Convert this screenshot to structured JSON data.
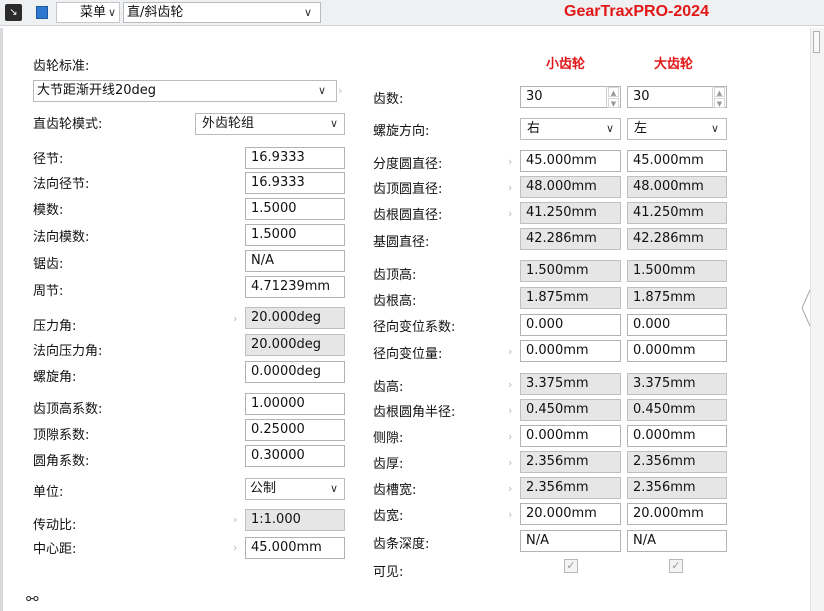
{
  "toolbar": {
    "menu_label": "菜单",
    "gear_type": "直/斜齿轮",
    "app_title": "GearTraxPRO-2024"
  },
  "left": {
    "standard_label": "齿轮标准:",
    "standard_value": "大节距渐开线20deg",
    "mode_label": "直齿轮模式:",
    "mode_value": "外齿轮组",
    "rows": [
      {
        "label": "径节:",
        "value": "16.9333"
      },
      {
        "label": "法向径节:",
        "value": "16.9333"
      },
      {
        "label": "模数:",
        "value": "1.5000"
      },
      {
        "label": "法向模数:",
        "value": "1.5000"
      },
      {
        "label": "锯齿:",
        "value": "N/A"
      },
      {
        "label": "周节:",
        "value": "4.71239mm"
      },
      {
        "label": "压力角:",
        "value": "20.000deg"
      },
      {
        "label": "法向压力角:",
        "value": "20.000deg"
      },
      {
        "label": "螺旋角:",
        "value": "0.0000deg"
      },
      {
        "label": "齿顶高系数:",
        "value": "1.00000"
      },
      {
        "label": "顶隙系数:",
        "value": "0.25000"
      },
      {
        "label": "圆角系数:",
        "value": "0.30000"
      }
    ],
    "unit_label": "单位:",
    "unit_value": "公制",
    "ratio_label": "传动比:",
    "ratio_value": "1:1.000",
    "center_label": "中心距:",
    "center_value": "45.000mm"
  },
  "right": {
    "pinion_header": "小齿轮",
    "gear_header": "大齿轮",
    "teeth_label": "齿数:",
    "pinion_teeth": "30",
    "gear_teeth": "30",
    "helix_label": "螺旋方向:",
    "pinion_helix": "右",
    "gear_helix": "左",
    "rows": [
      {
        "label": "分度圆直径:",
        "pinion": "45.000mm",
        "gear": "45.000mm"
      },
      {
        "label": "齿顶圆直径:",
        "pinion": "48.000mm",
        "gear": "48.000mm"
      },
      {
        "label": "齿根圆直径:",
        "pinion": "41.250mm",
        "gear": "41.250mm"
      },
      {
        "label": "基圆直径:",
        "pinion": "42.286mm",
        "gear": "42.286mm"
      },
      {
        "label": "齿顶高:",
        "pinion": "1.500mm",
        "gear": "1.500mm"
      },
      {
        "label": "齿根高:",
        "pinion": "1.875mm",
        "gear": "1.875mm"
      },
      {
        "label": "径向变位系数:",
        "pinion": "0.000",
        "gear": "0.000"
      },
      {
        "label": "径向变位量:",
        "pinion": "0.000mm",
        "gear": "0.000mm"
      },
      {
        "label": "齿高:",
        "pinion": "3.375mm",
        "gear": "3.375mm"
      },
      {
        "label": "齿根圆角半径:",
        "pinion": "0.450mm",
        "gear": "0.450mm"
      },
      {
        "label": "侧隙:",
        "pinion": "0.000mm",
        "gear": "0.000mm"
      },
      {
        "label": "齿厚:",
        "pinion": "2.356mm",
        "gear": "2.356mm"
      },
      {
        "label": "齿槽宽:",
        "pinion": "2.356mm",
        "gear": "2.356mm"
      },
      {
        "label": "齿宽:",
        "pinion": "20.000mm",
        "gear": "20.000mm"
      },
      {
        "label": "齿条深度:",
        "pinion": "N/A",
        "gear": "N/A"
      }
    ],
    "visible_label": "可见:",
    "pinion_visible": true,
    "gear_visible": true
  }
}
